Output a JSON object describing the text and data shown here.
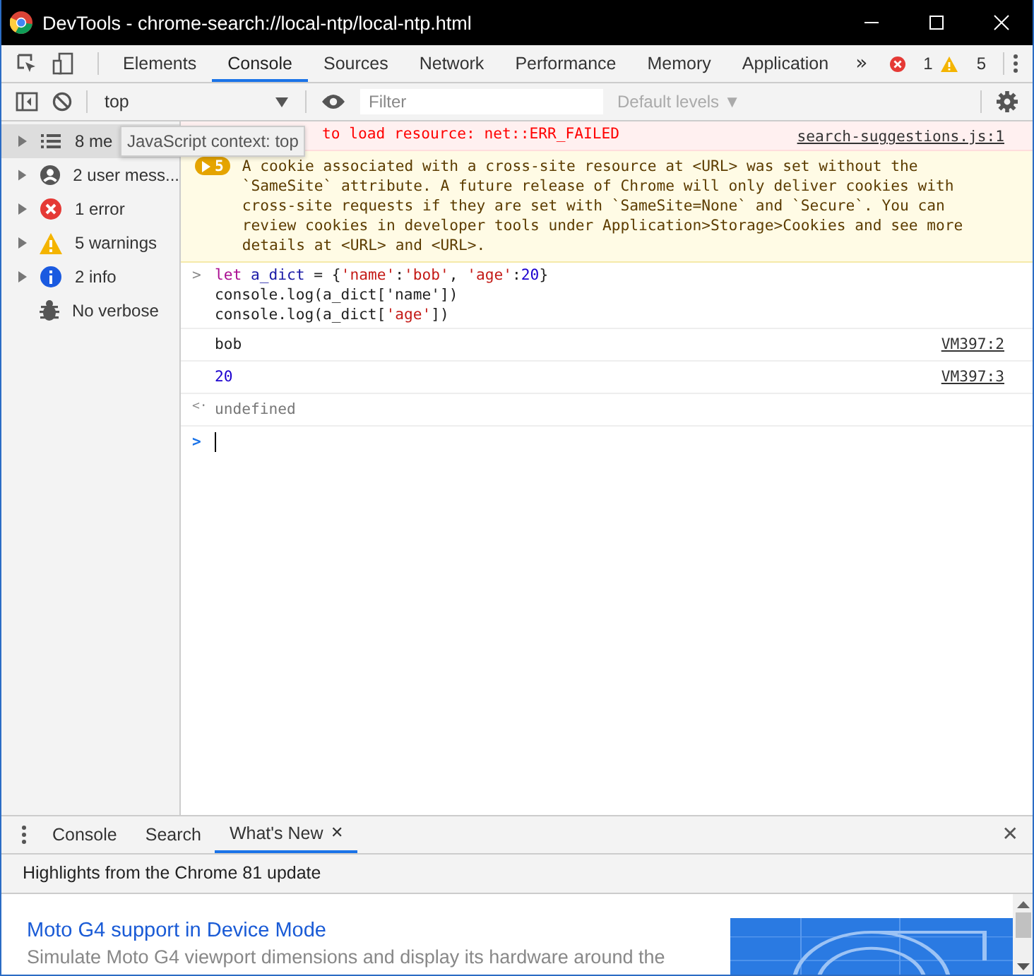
{
  "window": {
    "title": "DevTools - chrome-search://local-ntp/local-ntp.html"
  },
  "tabs": [
    {
      "label": "Elements",
      "selected": false
    },
    {
      "label": "Console",
      "selected": true
    },
    {
      "label": "Sources",
      "selected": false
    },
    {
      "label": "Network",
      "selected": false
    },
    {
      "label": "Performance",
      "selected": false
    },
    {
      "label": "Memory",
      "selected": false
    },
    {
      "label": "Application",
      "selected": false
    }
  ],
  "more_tabs": "»",
  "counts": {
    "errors": "1",
    "warnings": "5"
  },
  "toolbar": {
    "context": "top",
    "filter_placeholder": "Filter",
    "levels": "Default levels ▼"
  },
  "tooltip": "JavaScript context: top",
  "sidebar": {
    "items": [
      {
        "label": "8 me",
        "kind": "list",
        "selected": true,
        "expandable": true
      },
      {
        "label": "2 user mess...",
        "kind": "user",
        "selected": false,
        "expandable": true
      },
      {
        "label": "1 error",
        "kind": "error",
        "selected": false,
        "expandable": true
      },
      {
        "label": "5 warnings",
        "kind": "warning",
        "selected": false,
        "expandable": true
      },
      {
        "label": "2 info",
        "kind": "info",
        "selected": false,
        "expandable": true
      },
      {
        "label": "No verbose",
        "kind": "verbose",
        "selected": false,
        "expandable": false
      }
    ]
  },
  "messages": [
    {
      "kind": "error",
      "text": "to load resource: net::ERR_FAILED",
      "source": "search-suggestions.js:1"
    },
    {
      "kind": "warning",
      "count": "5",
      "text": "A cookie associated with a cross-site resource at <URL> was set without the `SameSite` attribute. A future release of Chrome will only deliver cookies with cross-site requests if they are set with `SameSite=None` and `Secure`. You can review cookies in developer tools under Application>Storage>Cookies and see more details at <URL> and <URL>."
    },
    {
      "kind": "input",
      "prompt": ">",
      "lines": [
        [
          {
            "t": "let",
            "kind": "keyword"
          },
          {
            "t": " a_dict",
            "kind": "variable"
          },
          {
            "t": " = {",
            "kind": "plain"
          },
          {
            "t": "'name'",
            "kind": "string"
          },
          {
            "t": ":",
            "kind": "plain"
          },
          {
            "t": "'bob'",
            "kind": "string"
          },
          {
            "t": ", ",
            "kind": "plain"
          },
          {
            "t": "'age'",
            "kind": "string"
          },
          {
            "t": ":",
            "kind": "plain"
          },
          {
            "t": "20",
            "kind": "number"
          },
          {
            "t": "}",
            "kind": "plain"
          }
        ],
        [
          {
            "t": "console.log(a_dict['name'])",
            "kind": "plain"
          }
        ],
        [
          {
            "t": "console.log(a_dict[",
            "kind": "plain"
          },
          {
            "t": "'age'",
            "kind": "string"
          },
          {
            "t": "])",
            "kind": "plain"
          }
        ]
      ]
    },
    {
      "kind": "string_log",
      "text": "bob",
      "source": "VM397:2"
    },
    {
      "kind": "number_log",
      "text": "20",
      "source": "VM397:3"
    },
    {
      "kind": "result",
      "prompt": "<·",
      "text": "undefined"
    },
    {
      "kind": "prompt",
      "prompt": ">"
    }
  ],
  "drawer": {
    "tabs": [
      {
        "label": "Console",
        "selected": false,
        "closable": false
      },
      {
        "label": "Search",
        "selected": false,
        "closable": false
      },
      {
        "label": "What's New",
        "selected": true,
        "closable": true
      }
    ],
    "close": "✕",
    "tab_close": "✕",
    "heading": "Highlights from the Chrome 81 update",
    "item": {
      "title": "Moto G4 support in Device Mode",
      "description": "Simulate Moto G4 viewport dimensions and display its hardware around the"
    }
  }
}
